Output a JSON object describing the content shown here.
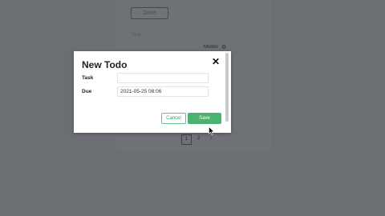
{
  "background": {
    "done_button_label": "Done",
    "column_task_label": "Task",
    "modes_label": "Modes",
    "gear_icon": "gear-icon",
    "pagination": {
      "page_1": "1",
      "page_2": "2",
      "next": "›"
    }
  },
  "modal": {
    "title": "New Todo",
    "close_icon": "✕",
    "fields": {
      "task": {
        "label": "Task",
        "value": ""
      },
      "due": {
        "label": "Due",
        "value": "2021-05-25 08:06"
      }
    },
    "buttons": {
      "cancel": "Cancel",
      "save": "Save"
    }
  },
  "colors": {
    "overlay": "#6b6e73",
    "accent": "#4cb272",
    "accent_border": "#6fb98a"
  }
}
